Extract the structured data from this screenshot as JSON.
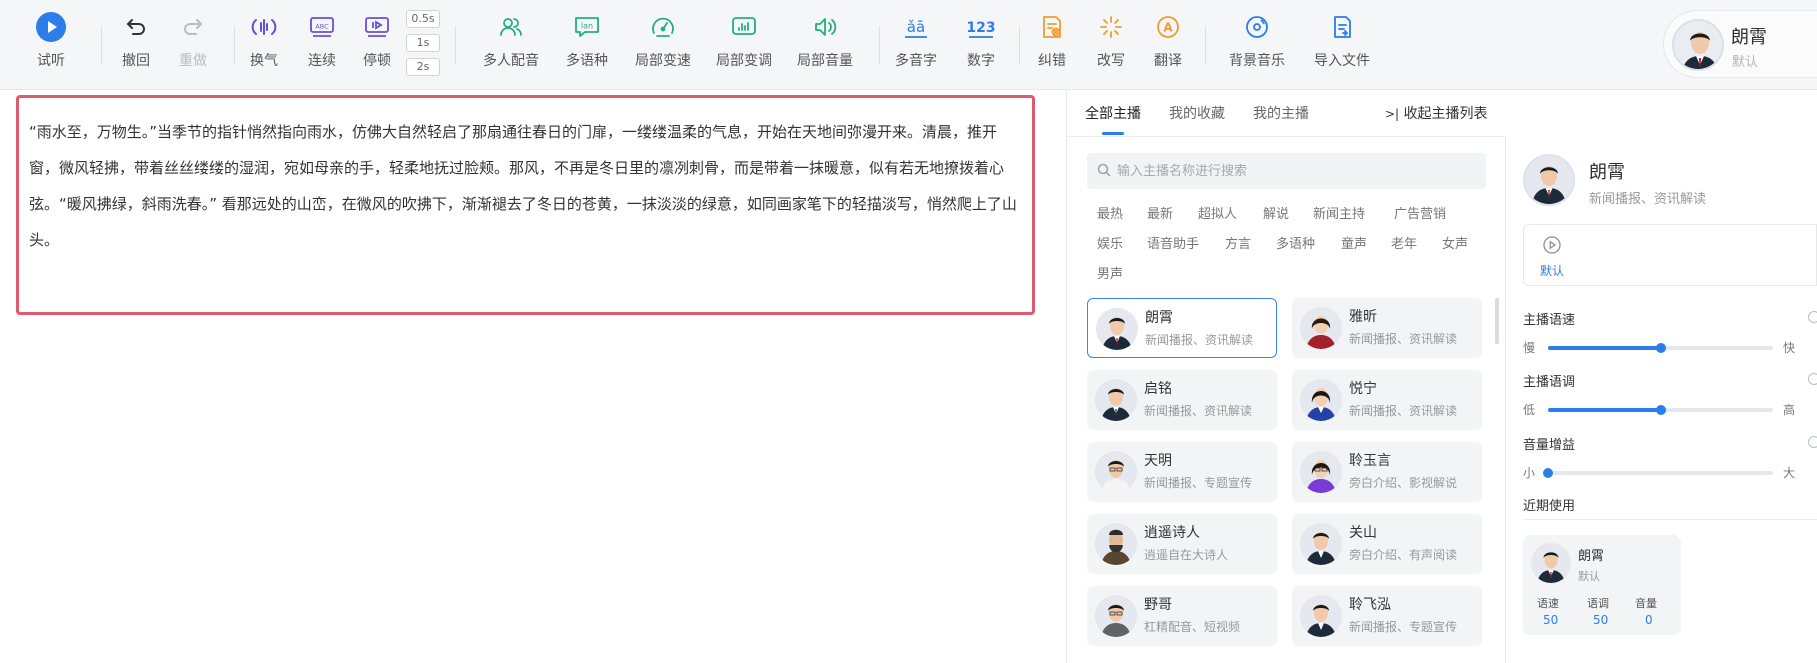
{
  "toolbar": {
    "play": "试听",
    "undo": "撤回",
    "redo": "重做",
    "breath": "换气",
    "continuous": "连续",
    "pause": "停顿",
    "pause_durations": [
      "0.5s",
      "1s",
      "2s"
    ],
    "multi_role": "多人配音",
    "multi_lang": "多语种",
    "local_speed": "局部变速",
    "local_pitch": "局部变调",
    "local_volume": "局部音量",
    "polyphone": "多音字",
    "number": "数字",
    "correct": "纠错",
    "rewrite": "改写",
    "translate": "翻译",
    "bgm": "背景音乐",
    "import_file": "导入文件"
  },
  "user": {
    "name": "朗霄",
    "style": "默认"
  },
  "editor": {
    "text": "“雨水至，万物生。”当季节的指针悄然指向雨水，仿佛大自然轻启了那扇通往春日的门扉，一缕缕温柔的气息，开始在天地间弥漫开来。清晨，推开窗，微风轻拂，带着丝丝缕缕的湿润，宛如母亲的手，轻柔地抚过脸颊。那风，不再是冬日里的凛冽刺骨，而是带着一抹暖意，似有若无地撩拨着心弦。“暖风拂绿，斜雨洗春。” 看那远处的山峦，在微风的吹拂下，渐渐褪去了冬日的苍黄，一抹淡淡的绿意，如同画家笔下的轻描淡写，悄然爬上了山头。"
  },
  "voice_panel": {
    "tabs": [
      "全部主播",
      "我的收藏",
      "我的主播"
    ],
    "collapse": "收起主播列表",
    "search_placeholder": "输入主播名称进行搜索",
    "tags": [
      "最热",
      "最新",
      "超拟人",
      "解说",
      "新闻主持",
      "广告营销",
      "娱乐",
      "语音助手",
      "方言",
      "多语种",
      "童声",
      "老年",
      "女声",
      "男声"
    ],
    "voices": [
      {
        "name": "朗霄",
        "desc": "新闻播报、资讯解读"
      },
      {
        "name": "雅昕",
        "desc": "新闻播报、资讯解读"
      },
      {
        "name": "启铭",
        "desc": "新闻播报、资讯解读"
      },
      {
        "name": "悦宁",
        "desc": "新闻播报、资讯解读"
      },
      {
        "name": "天明",
        "desc": "新闻播报、专题宣传"
      },
      {
        "name": "聆玉言",
        "desc": "旁白介绍、影视解说"
      },
      {
        "name": "逍遥诗人",
        "desc": "逍遥自在大诗人"
      },
      {
        "name": "关山",
        "desc": "旁白介绍、有声阅读"
      },
      {
        "name": "野哥",
        "desc": "杠精配音、短视频"
      },
      {
        "name": "聆飞泓",
        "desc": "新闻播报、专题宣传"
      }
    ]
  },
  "detail": {
    "name": "朗霄",
    "desc": "新闻播报、资讯解读",
    "style_default": "默认",
    "speed": {
      "title": "主播语速",
      "low": "慢",
      "high": "快",
      "value": 0.5
    },
    "pitch": {
      "title": "主播语调",
      "low": "低",
      "high": "高",
      "value": 0.5
    },
    "gain": {
      "title": "音量增益",
      "low": "小",
      "high": "大",
      "value": 0.0
    },
    "recent_title": "近期使用",
    "recent": {
      "name": "朗霄",
      "style": "默认",
      "speed_label": "语速",
      "speed_value": "50",
      "pitch_label": "语调",
      "pitch_value": "50",
      "volume_label": "音量",
      "volume_value": "0"
    }
  },
  "colors": {
    "accent": "#2b7de9",
    "editor_border": "#e05a6e"
  }
}
